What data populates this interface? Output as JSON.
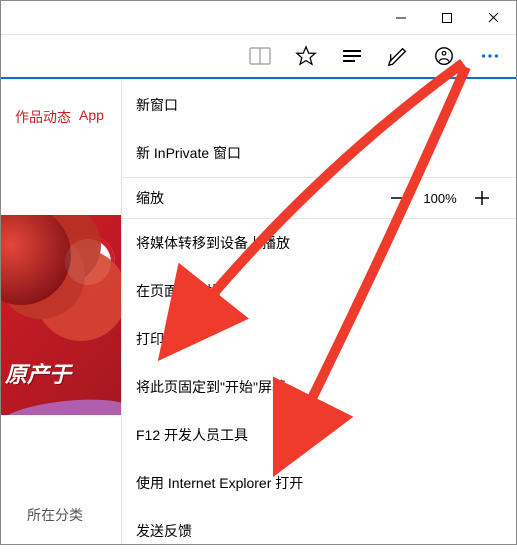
{
  "titlebar": {
    "minimize_icon": "minimize-icon",
    "maximize_icon": "maximize-icon",
    "close_icon": "close-icon"
  },
  "toolbar": {
    "reading_icon": "reading-view-icon",
    "star_icon": "star-icon",
    "hub_icon": "hub-icon",
    "note_icon": "web-note-icon",
    "share_icon": "share-icon",
    "more_icon": "more-icon"
  },
  "page": {
    "tab_works": "作品动态",
    "tab_app": "App",
    "promo_text": "原产于",
    "category_label": "所在分类"
  },
  "menu": {
    "new_window": "新窗口",
    "new_inprivate": "新 InPrivate 窗口",
    "zoom_label": "缩放",
    "zoom_value": "100%",
    "cast": "将媒体转移到设备上播放",
    "find": "在页面上查找",
    "print": "打印",
    "pin": "将此页固定到\"开始\"屏幕",
    "devtools": "F12 开发人员工具",
    "open_ie": "使用 Internet Explorer 打开",
    "feedback": "发送反馈"
  }
}
